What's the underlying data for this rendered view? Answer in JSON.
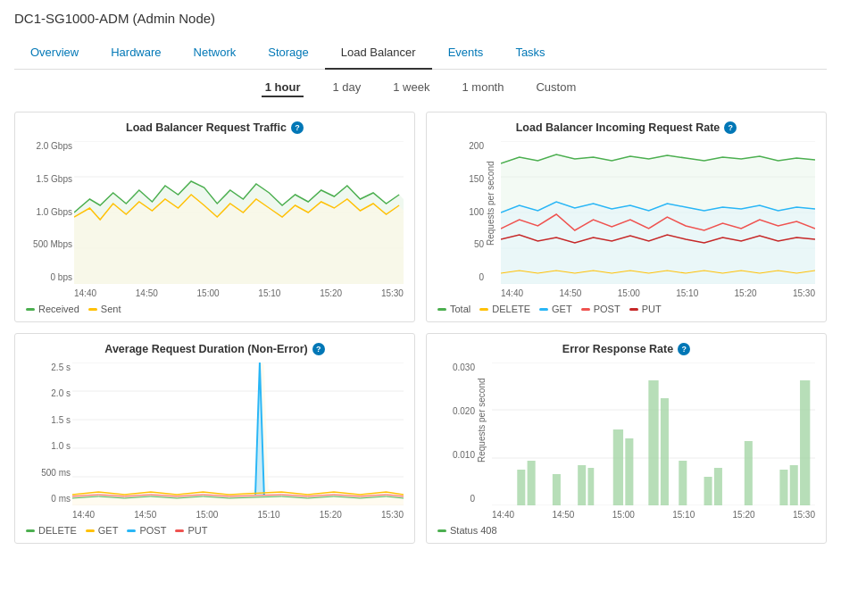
{
  "page": {
    "title": "DC1-SG1000-ADM (Admin Node)"
  },
  "tabs": [
    {
      "id": "overview",
      "label": "Overview",
      "active": false
    },
    {
      "id": "hardware",
      "label": "Hardware",
      "active": false
    },
    {
      "id": "network",
      "label": "Network",
      "active": false
    },
    {
      "id": "storage",
      "label": "Storage",
      "active": false
    },
    {
      "id": "load-balancer",
      "label": "Load Balancer",
      "active": true
    },
    {
      "id": "events",
      "label": "Events",
      "active": false
    },
    {
      "id": "tasks",
      "label": "Tasks",
      "active": false
    }
  ],
  "time_buttons": [
    {
      "id": "1hour",
      "label": "1 hour",
      "active": true
    },
    {
      "id": "1day",
      "label": "1 day",
      "active": false
    },
    {
      "id": "1week",
      "label": "1 week",
      "active": false
    },
    {
      "id": "1month",
      "label": "1 month",
      "active": false
    },
    {
      "id": "custom",
      "label": "Custom",
      "active": false
    }
  ],
  "charts": {
    "traffic": {
      "title": "Load Balancer Request Traffic",
      "y_ticks": [
        "2.0 Gbps",
        "1.5 Gbps",
        "1.0 Gbps",
        "500 Mbps",
        "0 bps"
      ],
      "x_ticks": [
        "14:40",
        "14:50",
        "15:00",
        "15:10",
        "15:20",
        "15:30"
      ],
      "legend": [
        {
          "label": "Received",
          "color": "#4caf50"
        },
        {
          "label": "Sent",
          "color": "#ffc107"
        }
      ]
    },
    "incoming": {
      "title": "Load Balancer Incoming Request Rate",
      "y_label": "Requests per second",
      "y_ticks": [
        "200",
        "150",
        "100",
        "50",
        "0"
      ],
      "x_ticks": [
        "14:40",
        "14:50",
        "15:00",
        "15:10",
        "15:20",
        "15:30"
      ],
      "legend": [
        {
          "label": "Total",
          "color": "#4caf50"
        },
        {
          "label": "DELETE",
          "color": "#ffc107"
        },
        {
          "label": "GET",
          "color": "#29b6f6"
        },
        {
          "label": "POST",
          "color": "#ef5350"
        },
        {
          "label": "PUT",
          "color": "#c62828"
        }
      ]
    },
    "duration": {
      "title": "Average Request Duration (Non-Error)",
      "y_ticks": [
        "2.5 s",
        "2.0 s",
        "1.5 s",
        "1.0 s",
        "500 ms",
        "0 ms"
      ],
      "x_ticks": [
        "14:40",
        "14:50",
        "15:00",
        "15:10",
        "15:20",
        "15:30"
      ],
      "legend": [
        {
          "label": "DELETE",
          "color": "#4caf50"
        },
        {
          "label": "GET",
          "color": "#ffc107"
        },
        {
          "label": "POST",
          "color": "#29b6f6"
        },
        {
          "label": "PUT",
          "color": "#ef5350"
        }
      ]
    },
    "error": {
      "title": "Error Response Rate",
      "y_label": "Requests per second",
      "y_ticks": [
        "0.030",
        "0.020",
        "0.010",
        "0"
      ],
      "x_ticks": [
        "14:40",
        "14:50",
        "15:00",
        "15:10",
        "15:20",
        "15:30"
      ],
      "legend": [
        {
          "label": "Status 408",
          "color": "#4caf50"
        }
      ]
    }
  },
  "info_icon_label": "?"
}
